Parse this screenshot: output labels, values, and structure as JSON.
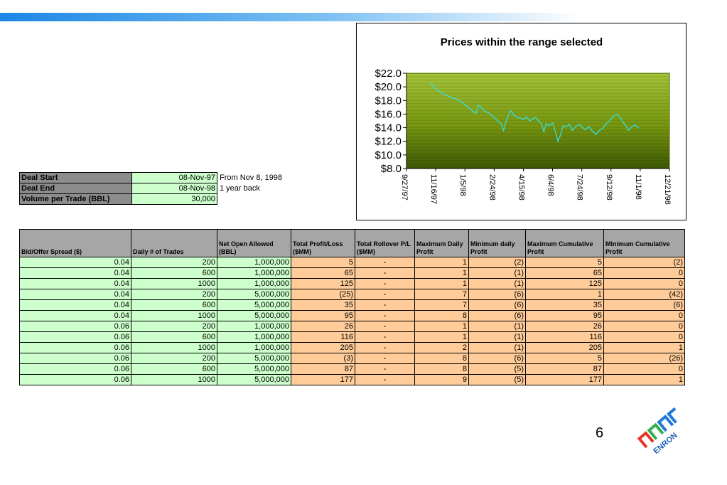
{
  "deal": {
    "rows": [
      {
        "label": "Deal Start",
        "value": "08-Nov-97",
        "note": "From Nov 8, 1998"
      },
      {
        "label": "Deal End",
        "value": "08-Nov-98",
        "note": "1 year back"
      },
      {
        "label": "Volume per Trade (BBL)",
        "value": "30,000",
        "note": ""
      }
    ]
  },
  "chart_data": {
    "type": "line",
    "title": "Prices within the range selected",
    "xlabel": "",
    "ylabel": "",
    "y_ticks": [
      "$22.0",
      "$20.0",
      "$18.0",
      "$16.0",
      "$14.0",
      "$12.0",
      "$10.0",
      "$8.0"
    ],
    "ylim": [
      8,
      22
    ],
    "x_ticks": [
      "9/27/97",
      "11/16/97",
      "1/5/98",
      "2/24/98",
      "4/15/98",
      "6/4/98",
      "7/24/98",
      "9/12/98",
      "11/1/98",
      "12/21/98"
    ],
    "xlim": [
      "9/27/97",
      "12/21/98"
    ],
    "grid": false,
    "background": "#7a9a10",
    "line_color": "#33e0e0",
    "series": [
      {
        "points": [
          [
            "11/8/97",
            20.6
          ],
          [
            "11/12/97",
            20.0
          ],
          [
            "11/16/97",
            19.7
          ],
          [
            "11/22/97",
            19.4
          ],
          [
            "11/28/97",
            19.0
          ],
          [
            "12/6/97",
            18.7
          ],
          [
            "12/14/97",
            18.4
          ],
          [
            "12/22/97",
            18.2
          ],
          [
            "12/30/97",
            17.8
          ],
          [
            "1/5/98",
            17.4
          ],
          [
            "1/12/98",
            16.9
          ],
          [
            "1/19/98",
            16.4
          ],
          [
            "1/24/98",
            16.1
          ],
          [
            "1/28/98",
            17.3
          ],
          [
            "2/2/98",
            17.0
          ],
          [
            "2/8/98",
            16.4
          ],
          [
            "2/14/98",
            16.2
          ],
          [
            "2/20/98",
            15.8
          ],
          [
            "2/24/98",
            15.5
          ],
          [
            "3/2/98",
            15.0
          ],
          [
            "3/8/98",
            14.6
          ],
          [
            "3/12/98",
            13.6
          ],
          [
            "3/16/98",
            14.8
          ],
          [
            "3/21/98",
            16.0
          ],
          [
            "3/25/98",
            16.5
          ],
          [
            "3/30/98",
            15.8
          ],
          [
            "4/5/98",
            15.5
          ],
          [
            "4/10/98",
            15.4
          ],
          [
            "4/15/98",
            15.2
          ],
          [
            "4/20/98",
            15.6
          ],
          [
            "4/26/98",
            15.0
          ],
          [
            "5/1/98",
            15.3
          ],
          [
            "5/6/98",
            15.5
          ],
          [
            "5/10/98",
            15.1
          ],
          [
            "5/16/98",
            14.6
          ],
          [
            "5/20/98",
            13.4
          ],
          [
            "5/24/98",
            14.6
          ],
          [
            "5/29/98",
            14.3
          ],
          [
            "6/4/98",
            14.7
          ],
          [
            "6/9/98",
            13.4
          ],
          [
            "6/13/98",
            12.0
          ],
          [
            "6/17/98",
            12.8
          ],
          [
            "6/22/98",
            14.3
          ],
          [
            "6/27/98",
            14.1
          ],
          [
            "7/2/98",
            14.5
          ],
          [
            "7/8/98",
            13.6
          ],
          [
            "7/14/98",
            14.2
          ],
          [
            "7/20/98",
            14.5
          ],
          [
            "7/24/98",
            14.1
          ],
          [
            "7/30/98",
            13.7
          ],
          [
            "8/5/98",
            14.2
          ],
          [
            "8/11/98",
            13.5
          ],
          [
            "8/17/98",
            13.0
          ],
          [
            "8/23/98",
            13.6
          ],
          [
            "8/29/98",
            13.9
          ],
          [
            "9/4/98",
            14.6
          ],
          [
            "9/8/98",
            14.9
          ],
          [
            "9/12/98",
            15.3
          ],
          [
            "9/18/98",
            15.8
          ],
          [
            "9/23/98",
            16.0
          ],
          [
            "9/28/98",
            15.4
          ],
          [
            "10/3/98",
            14.8
          ],
          [
            "10/8/98",
            14.2
          ],
          [
            "10/12/98",
            13.6
          ],
          [
            "10/17/98",
            14.1
          ],
          [
            "10/23/98",
            14.4
          ],
          [
            "10/29/98",
            14.0
          ]
        ]
      }
    ]
  },
  "results": {
    "headers": [
      "Bid/Offer Spread ($)",
      "Daily # of Trades",
      "Net Open Allowed (BBL)",
      "Total Profit/Loss ($MM)",
      "Total Rollover P/L ($MM)",
      "Maximum Daily Profit",
      "Minimum daily Profit",
      "Maximum Cumulative Profit",
      "Minimum Cumulative Profit"
    ],
    "rows": [
      [
        "0.04",
        "200",
        "1,000,000",
        "5",
        "-",
        "1",
        "(2)",
        "5",
        "(2)"
      ],
      [
        "0.04",
        "600",
        "1,000,000",
        "65",
        "-",
        "1",
        "(1)",
        "65",
        "0"
      ],
      [
        "0.04",
        "1000",
        "1,000,000",
        "125",
        "-",
        "1",
        "(1)",
        "125",
        "0"
      ],
      [
        "0.04",
        "200",
        "5,000,000",
        "(25)",
        "-",
        "7",
        "(6)",
        "1",
        "(42)"
      ],
      [
        "0.04",
        "600",
        "5,000,000",
        "35",
        "-",
        "7",
        "(6)",
        "35",
        "(6)"
      ],
      [
        "0.04",
        "1000",
        "5,000,000",
        "95",
        "-",
        "8",
        "(6)",
        "95",
        "0"
      ],
      [
        "0.06",
        "200",
        "1,000,000",
        "26",
        "-",
        "1",
        "(1)",
        "26",
        "0"
      ],
      [
        "0.06",
        "600",
        "1,000,000",
        "116",
        "-",
        "1",
        "(1)",
        "116",
        "0"
      ],
      [
        "0.06",
        "1000",
        "1,000,000",
        "205",
        "-",
        "2",
        "(1)",
        "205",
        "1"
      ],
      [
        "0.06",
        "200",
        "5,000,000",
        "(3)",
        "-",
        "8",
        "(6)",
        "5",
        "(26)"
      ],
      [
        "0.06",
        "600",
        "5,000,000",
        "87",
        "-",
        "8",
        "(5)",
        "87",
        "0"
      ],
      [
        "0.06",
        "1000",
        "5,000,000",
        "177",
        "-",
        "9",
        "(5)",
        "177",
        "1"
      ]
    ]
  },
  "footer": {
    "page_number": "6",
    "logo_text": "ENRON",
    "logo_icon": "enron-logo-icon"
  },
  "colors": {
    "header_gray": "#a6a6a6",
    "cell_green": "#ccffcc",
    "cell_orange": "#ffcc99",
    "logo_red": "#e8332a",
    "logo_green": "#2bb24c",
    "logo_blue": "#1f7ad4"
  }
}
